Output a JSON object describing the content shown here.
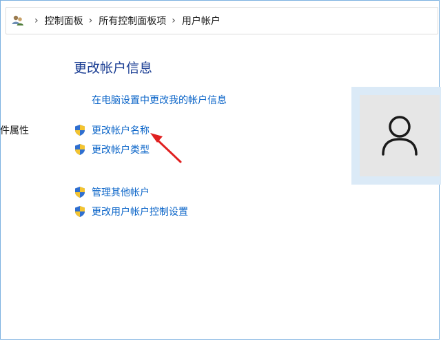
{
  "breadcrumb": {
    "items": [
      "控制面板",
      "所有控制面板项",
      "用户帐户"
    ],
    "separator": "›"
  },
  "page": {
    "title": "更改帐户信息",
    "pc_settings_link": "在电脑设置中更改我的帐户信息",
    "left_label": "文件属性"
  },
  "actions": {
    "change_name": "更改帐户名称",
    "change_type": "更改帐户类型",
    "manage_other": "管理其他帐户",
    "uac_settings": "更改用户帐户控制设置"
  },
  "icons": {
    "breadcrumb_icon": "users-icon",
    "shield": "uac-shield-icon",
    "avatar": "user-avatar-icon"
  },
  "colors": {
    "link": "#0a64c8",
    "title": "#1c3f94",
    "annotation_arrow": "#e02020"
  }
}
